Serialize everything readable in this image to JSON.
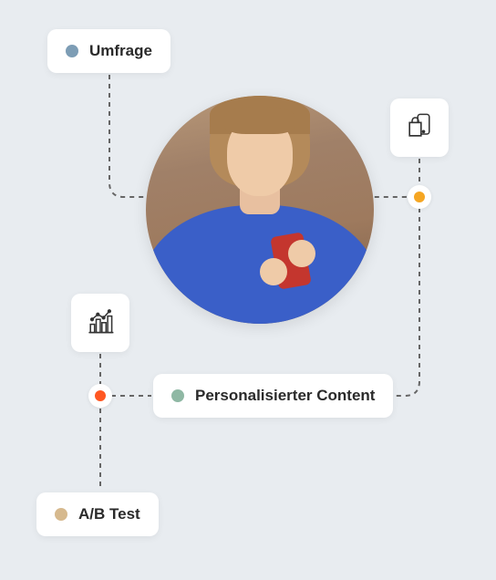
{
  "nodes": {
    "survey": {
      "label": "Umfrage",
      "dot_color": "#7d9db5"
    },
    "personalized": {
      "label": "Personalisierter Content",
      "dot_color": "#8fb8a4"
    },
    "abtest": {
      "label": "A/B Test",
      "dot_color": "#d6b98e"
    }
  },
  "connector_nodes": {
    "right": "#f5a623",
    "left": "#ff5722"
  },
  "icons": {
    "shopping": "shopping-bag-phone",
    "analytics": "analytics-chart"
  }
}
